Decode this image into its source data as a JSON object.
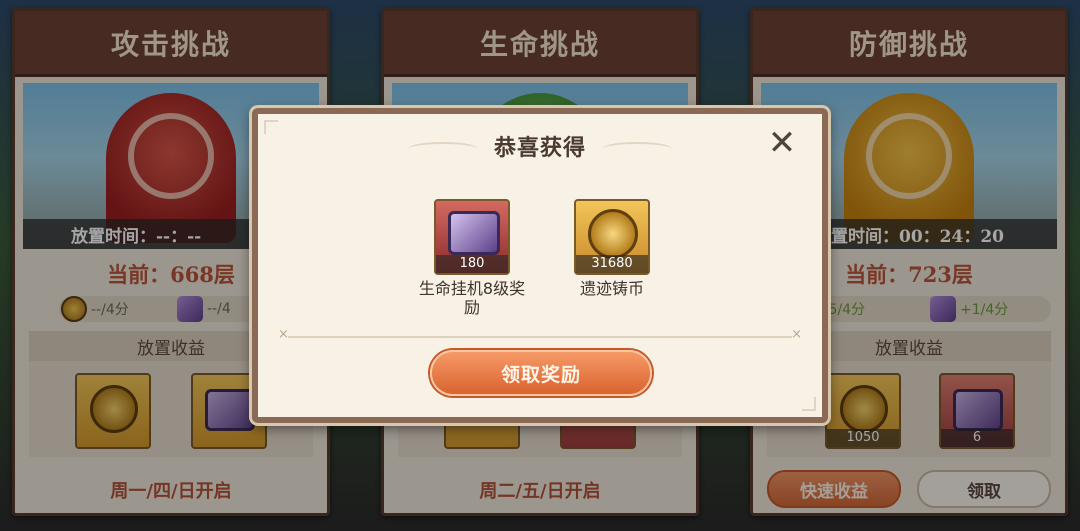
{
  "cards": [
    {
      "title": "攻击挑战",
      "idle_time": "放置时间：--：--",
      "floor": "当前：668层",
      "rates": [
        "--/4分",
        "--/4"
      ],
      "income_label": "放置收益",
      "slots": [
        {
          "type": "coin",
          "qty": ""
        },
        {
          "type": "chest",
          "qty": ""
        }
      ],
      "open_days": "周一/四/日开启"
    },
    {
      "title": "生命挑战",
      "open_days": "周二/五/日开启"
    },
    {
      "title": "防御挑战",
      "idle_time": "置时间：00：24：20",
      "floor": "当前：723层",
      "rates": [
        "+175/4分",
        "+1/4分"
      ],
      "income_label": "放置收益",
      "slots": [
        {
          "type": "coin",
          "qty": "1050"
        },
        {
          "type": "chest",
          "qty": "6"
        }
      ],
      "buttons": {
        "quick": "快速收益",
        "claim": "领取"
      }
    }
  ],
  "modal": {
    "title": "恭喜获得",
    "rewards": [
      {
        "name": "生命挂机8级奖励",
        "qty": "180",
        "icon": "chest-icon"
      },
      {
        "name": "遗迹铸币",
        "qty": "31680",
        "icon": "coin-icon"
      }
    ],
    "claim_button": "领取奖励"
  },
  "colors": {
    "card_header": "#6e4337",
    "accent_orange": "#d9632f",
    "floor_text": "#b8553b"
  }
}
